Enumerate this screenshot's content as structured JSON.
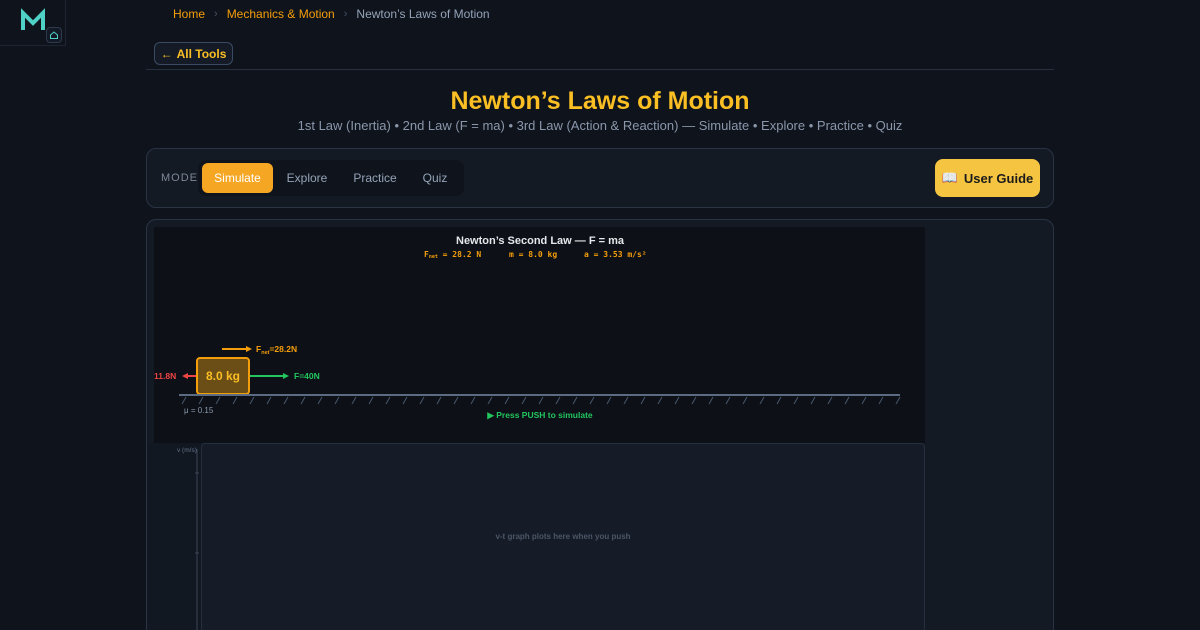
{
  "logo": {
    "letter": "M",
    "accent": "#4fd1c5"
  },
  "breadcrumb": {
    "home": "Home",
    "section": "Mechanics & Motion",
    "current": "Newton’s Laws of Motion",
    "sep": "›"
  },
  "nav": {
    "all_tools": "All Tools",
    "back_arrow": "←"
  },
  "header": {
    "title": "Newton’s Laws of Motion",
    "subtitle": "1st Law (Inertia) • 2nd Law (F = ma) • 3rd Law (Action & Reaction) — Simulate • Explore • Practice • Quiz"
  },
  "mode": {
    "label": "MODE",
    "tabs": [
      "Simulate",
      "Explore",
      "Practice",
      "Quiz"
    ],
    "active": "Simulate",
    "user_guide": "User Guide",
    "guide_icon": "📖"
  },
  "sim": {
    "title": "Newton’s Second Law — F = ma",
    "readout_fnet": "F",
    "readout_fnet_sub": "net",
    "readout_fnet_val": " = 28.2 N",
    "readout_m": "m = 8.0 kg",
    "readout_a": "a = 3.53 m/s²",
    "block_label": "8.0 kg",
    "fnet_label": "F",
    "fnet_sub": "net",
    "fnet_val": "=28.2N",
    "friction_label": "11.8N",
    "applied_label": "F=40N",
    "mu_label": "μ = 0.15",
    "hint": "▶ Press PUSH to simulate",
    "colors": {
      "fnet": "#f59e0b",
      "friction": "#ef4444",
      "applied": "#22c55e",
      "block_fill": "#7a5a1a",
      "block_stroke": "#f59e0b"
    }
  },
  "graph": {
    "ylabel": "v (m/s)",
    "placeholder": "v-t graph plots here when you push"
  }
}
